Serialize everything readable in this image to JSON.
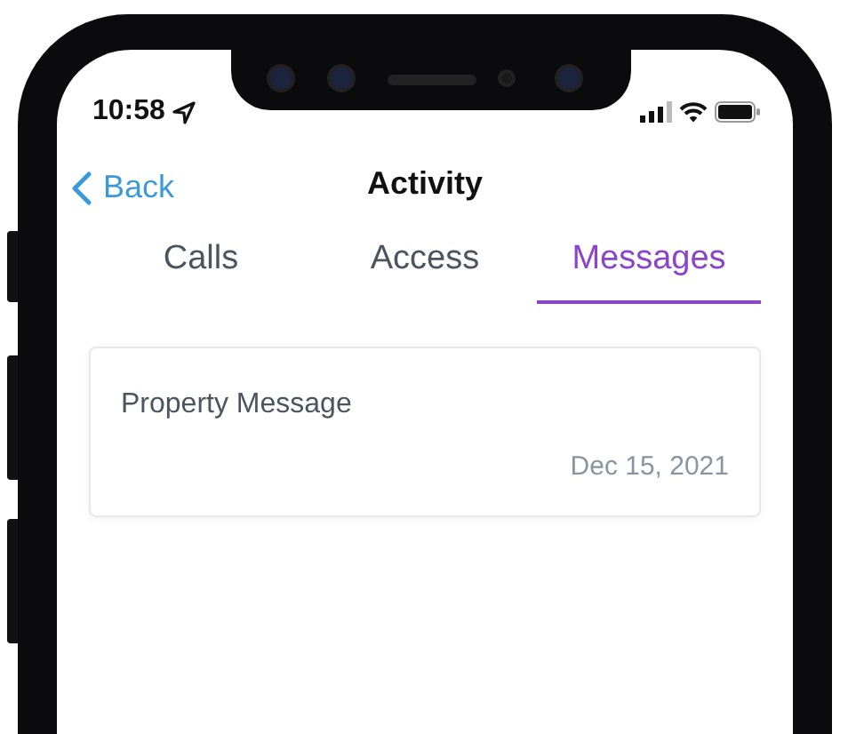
{
  "status_bar": {
    "time": "10:58"
  },
  "nav": {
    "back": "Back",
    "title": "Activity"
  },
  "tabs": [
    {
      "label": "Calls",
      "selected": false
    },
    {
      "label": "Access",
      "selected": false
    },
    {
      "label": "Messages",
      "selected": true
    }
  ],
  "messages": [
    {
      "title": "Property Message",
      "date": "Dec 15, 2021"
    }
  ]
}
